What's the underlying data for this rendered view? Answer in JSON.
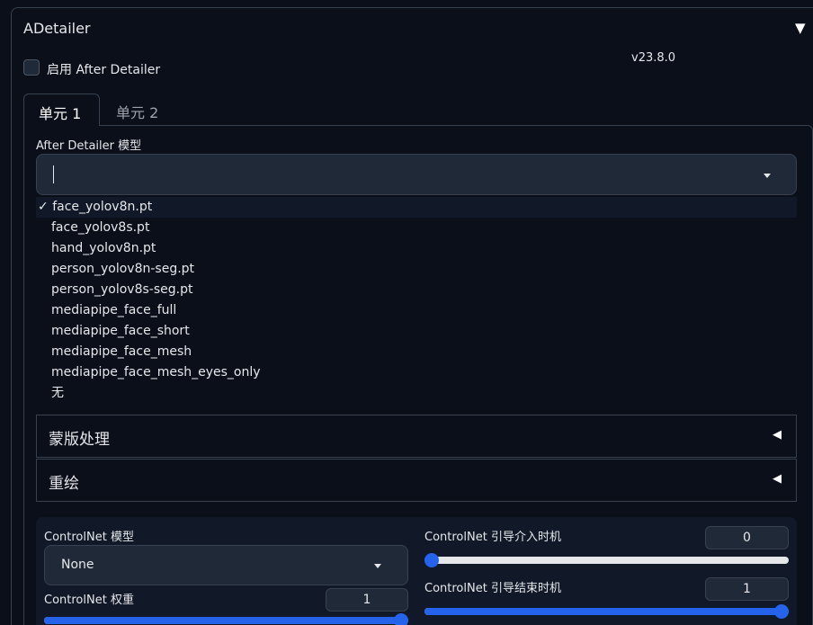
{
  "panel": {
    "title": "ADetailer",
    "collapse_icon": "triangle-down-icon"
  },
  "enable": {
    "label": "启用 After Detailer",
    "checked": false
  },
  "version": "v23.8.0",
  "tabs": [
    {
      "label": "单元 1",
      "active": true
    },
    {
      "label": "单元 2",
      "active": false
    }
  ],
  "model": {
    "label": "After Detailer 模型",
    "value": "",
    "options": [
      {
        "label": "face_yolov8n.pt",
        "selected": true,
        "check": "✓"
      },
      {
        "label": "face_yolov8s.pt"
      },
      {
        "label": "hand_yolov8n.pt"
      },
      {
        "label": "person_yolov8n-seg.pt"
      },
      {
        "label": "person_yolov8s-seg.pt"
      },
      {
        "label": "mediapipe_face_full"
      },
      {
        "label": "mediapipe_face_short"
      },
      {
        "label": "mediapipe_face_mesh"
      },
      {
        "label": "mediapipe_face_mesh_eyes_only"
      },
      {
        "label": "无"
      }
    ]
  },
  "accordions": [
    {
      "label": "蒙版处理",
      "collapsed": true
    },
    {
      "label": "重绘",
      "collapsed": true
    }
  ],
  "controlnet": {
    "model_label": "ControlNet 模型",
    "model_value": "None",
    "weight_label": "ControlNet 权重",
    "weight_value": "1",
    "weight_fraction": 1.0,
    "start_label": "ControlNet 引导介入时机",
    "start_value": "0",
    "start_fraction": 0.0,
    "end_label": "ControlNet 引导结束时机",
    "end_value": "1",
    "end_fraction": 1.0
  },
  "colors": {
    "accent": "#2563eb",
    "background": "#0b0f19",
    "input_bg": "#1f2937",
    "border": "#374151"
  }
}
